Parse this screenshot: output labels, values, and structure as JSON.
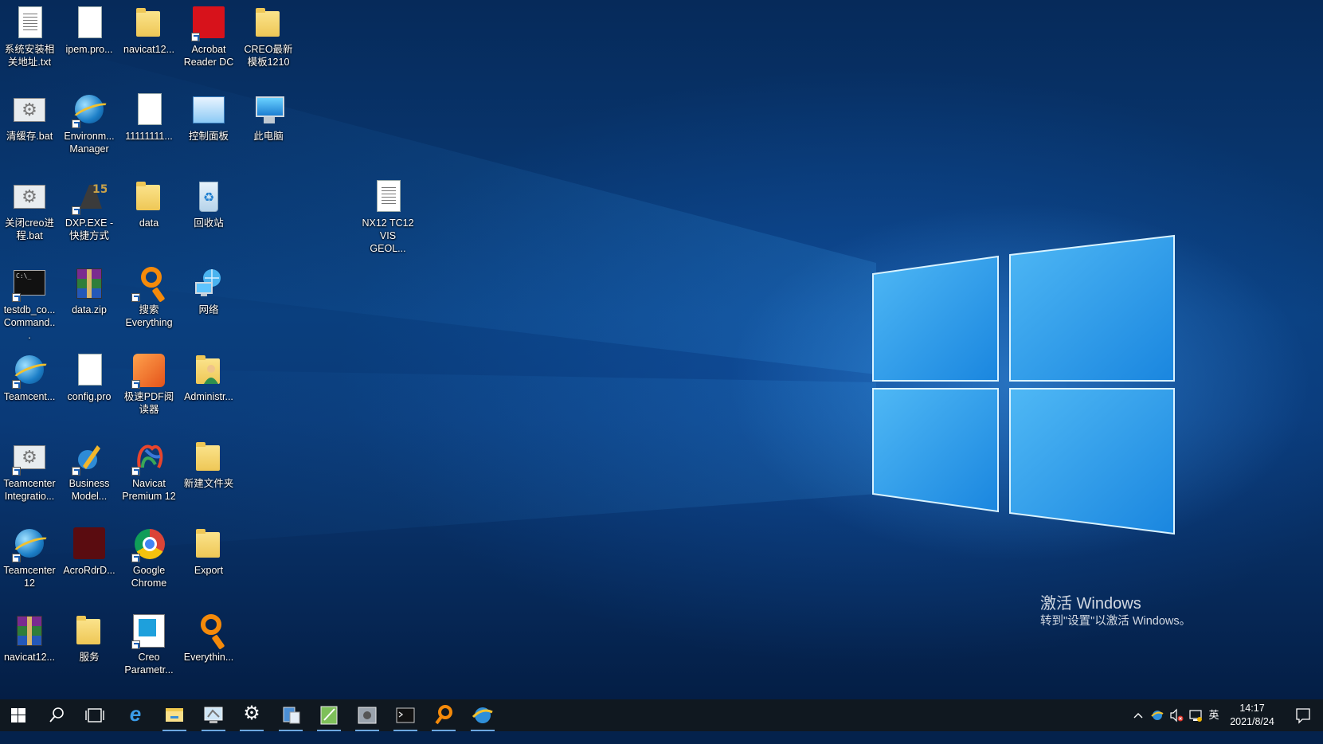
{
  "desktop": {
    "icons": [
      {
        "label": "系统安装相关地址.txt",
        "icon": "text-document-icon"
      },
      {
        "label": "ipem.pro...",
        "icon": "blank-document-icon"
      },
      {
        "label": "navicat12...",
        "icon": "folder-icon"
      },
      {
        "label": "Acrobat Reader DC",
        "icon": "acrobat-reader-icon"
      },
      {
        "label": "CREO最新模板1210",
        "icon": "folder-icon"
      },
      {
        "label": "清缓存.bat",
        "icon": "batch-file-icon"
      },
      {
        "label": "Environm... Manager",
        "icon": "environment-manager-icon"
      },
      {
        "label": "11111111...",
        "icon": "blank-document-icon"
      },
      {
        "label": "控制面板",
        "icon": "control-panel-icon"
      },
      {
        "label": "此电脑",
        "icon": "this-pc-icon"
      },
      {
        "label": "关闭creo进程.bat",
        "icon": "batch-file-icon"
      },
      {
        "label": "DXP.EXE - 快捷方式",
        "icon": "dxp-icon"
      },
      {
        "label": "data",
        "icon": "folder-icon"
      },
      {
        "label": "回收站",
        "icon": "recycle-bin-icon"
      },
      {
        "label": "NX12 TC12 VIS GEOL...",
        "icon": "text-document-icon"
      },
      {
        "label": "testdb_co... Command...",
        "icon": "command-prompt-icon"
      },
      {
        "label": "data.zip",
        "icon": "winrar-archive-icon"
      },
      {
        "label": "搜索 Everything",
        "icon": "everything-search-icon"
      },
      {
        "label": "网络",
        "icon": "network-icon"
      },
      {
        "label": "Teamcent...",
        "icon": "teamcenter-icon"
      },
      {
        "label": "config.pro",
        "icon": "blank-document-icon"
      },
      {
        "label": "极速PDF阅读器",
        "icon": "jisu-pdf-icon"
      },
      {
        "label": "Administr...",
        "icon": "user-folder-icon"
      },
      {
        "label": "Teamcenter Integratio...",
        "icon": "batch-file-icon"
      },
      {
        "label": "Business Model...",
        "icon": "business-modeler-icon"
      },
      {
        "label": "Navicat Premium 12",
        "icon": "navicat-icon"
      },
      {
        "label": "新建文件夹",
        "icon": "folder-icon"
      },
      {
        "label": "Teamcenter 12",
        "icon": "teamcenter-icon"
      },
      {
        "label": "AcroRdrD...",
        "icon": "acrobat-installer-icon"
      },
      {
        "label": "Google Chrome",
        "icon": "chrome-icon"
      },
      {
        "label": "Export",
        "icon": "folder-icon"
      },
      {
        "label": "navicat12...",
        "icon": "winrar-archive-icon"
      },
      {
        "label": "服务",
        "icon": "folder-icon"
      },
      {
        "label": "Creo Parametr...",
        "icon": "creo-icon"
      },
      {
        "label": "Everythin...",
        "icon": "everything-search-icon"
      }
    ]
  },
  "watermark": {
    "line1": "激活 Windows",
    "line2": "转到\"设置\"以激活 Windows。"
  },
  "taskbar": {
    "items": [
      {
        "icon": "start-windows-icon"
      },
      {
        "icon": "search-icon"
      },
      {
        "icon": "task-view-icon"
      },
      {
        "icon": "internet-explorer-icon"
      },
      {
        "icon": "file-explorer-icon"
      },
      {
        "icon": "remote-desktop-icon"
      },
      {
        "icon": "settings-gear-icon"
      },
      {
        "icon": "server-manager-icon"
      },
      {
        "icon": "notepad-app-icon"
      },
      {
        "icon": "system-config-icon"
      },
      {
        "icon": "command-prompt-icon"
      },
      {
        "icon": "everything-search-icon"
      },
      {
        "icon": "teamcenter-icon"
      }
    ],
    "tray": {
      "input_method": "英",
      "time": "14:17",
      "date": "2021/8/24"
    }
  },
  "colors": {
    "taskbar_bg": "#101820",
    "wallpaper_accent": "#1e8fe6"
  }
}
